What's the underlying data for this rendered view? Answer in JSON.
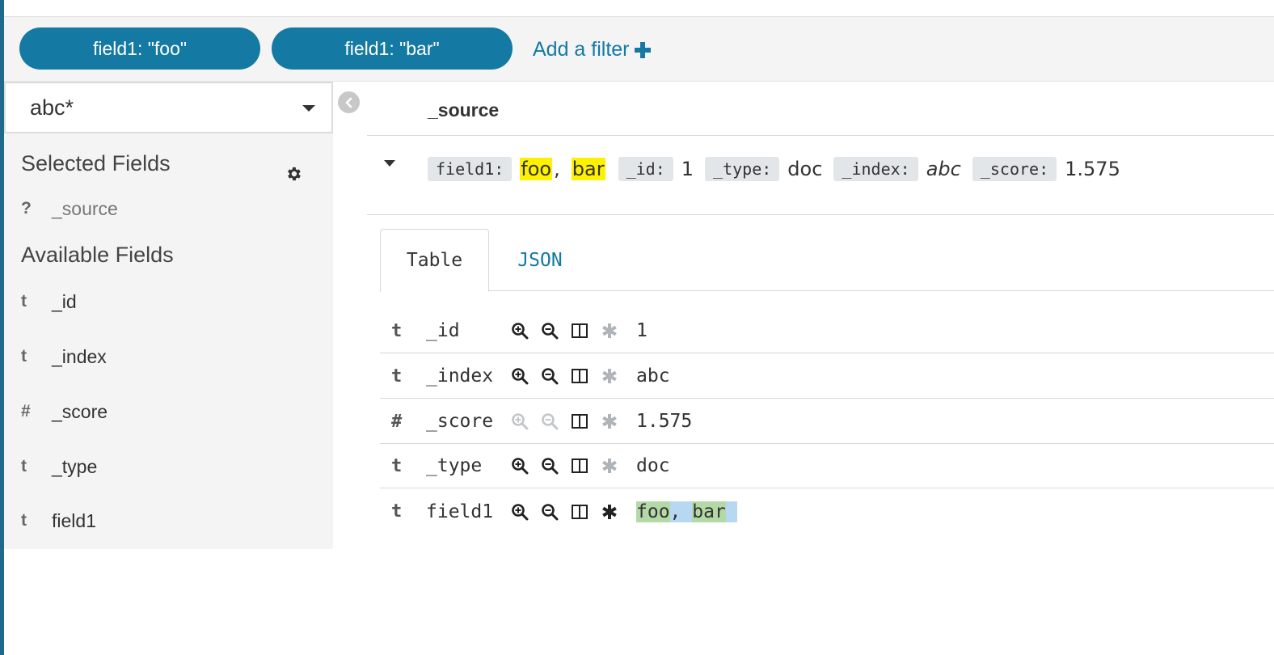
{
  "filters": [
    {
      "label": "field1: \"foo\""
    },
    {
      "label": "field1: \"bar\""
    }
  ],
  "add_filter_label": "Add a filter",
  "index_pattern": "abc*",
  "sidebar": {
    "selected_title": "Selected Fields",
    "selected_fields": [
      {
        "type": "?",
        "name": "_source"
      }
    ],
    "available_title": "Available Fields",
    "available_fields": [
      {
        "type": "t",
        "name": "_id"
      },
      {
        "type": "t",
        "name": "_index"
      },
      {
        "type": "#",
        "name": "_score"
      },
      {
        "type": "t",
        "name": "_type"
      },
      {
        "type": "t",
        "name": "field1"
      }
    ]
  },
  "doc": {
    "column_header": "_source",
    "summary": {
      "field1_key": "field1:",
      "field1_val1": "foo",
      "field1_sep": ",",
      "field1_val2": "bar",
      "id_key": "_id:",
      "id_val": "1",
      "type_key": "_type:",
      "type_val": "doc",
      "index_key": "_index:",
      "index_val": "abc",
      "score_key": "_score:",
      "score_val": "1.575"
    }
  },
  "tabs": {
    "table": "Table",
    "json": "JSON"
  },
  "table_rows": [
    {
      "type": "t",
      "name": "_id",
      "value": "1"
    },
    {
      "type": "t",
      "name": "_index",
      "value": "abc"
    },
    {
      "type": "#",
      "name": "_score",
      "value": "1.575"
    },
    {
      "type": "t",
      "name": "_type",
      "value": "doc"
    },
    {
      "type": "t",
      "name": "field1",
      "value_part1": "foo",
      "value_sep": ", ",
      "value_part2": "bar"
    }
  ],
  "colors": {
    "accent": "#147aa3",
    "highlight": "#fff200",
    "selection_green": "#b3d9a6",
    "selection_blue": "#b7d7f3"
  }
}
